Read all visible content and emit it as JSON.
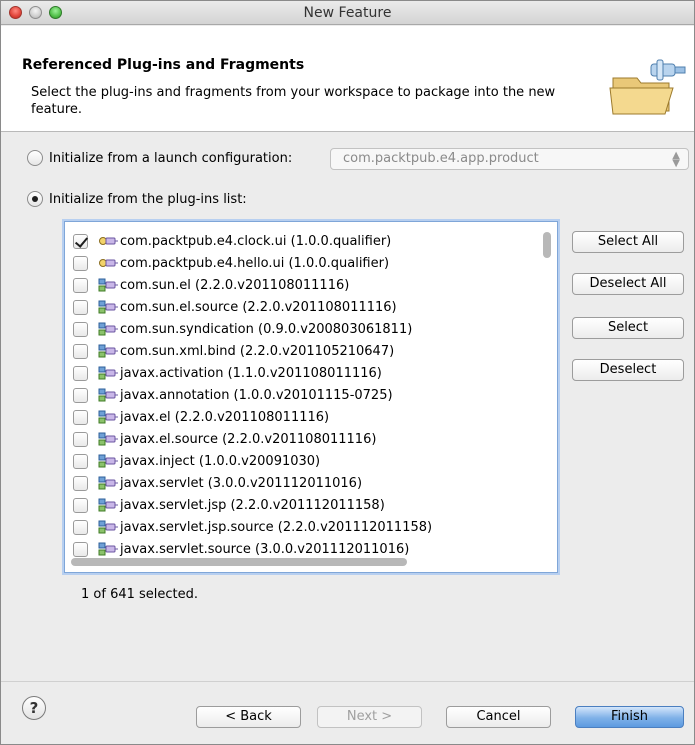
{
  "window": {
    "title": "New Feature"
  },
  "header": {
    "title": "Referenced Plug-ins and Fragments",
    "description": "Select the plug-ins and fragments from your workspace to package into the new feature."
  },
  "options": {
    "launch_config_label": "Initialize from a launch configuration:",
    "launch_config_value": "com.packtpub.e4.app.product",
    "plugins_list_label": "Initialize from the plug-ins list:",
    "selected_option": "plugins_list"
  },
  "plugins": [
    {
      "label": "com.packtpub.e4.clock.ui (1.0.0.qualifier)",
      "checked": true,
      "icon": "plugin-project-icon"
    },
    {
      "label": "com.packtpub.e4.hello.ui (1.0.0.qualifier)",
      "checked": false,
      "icon": "plugin-project-icon"
    },
    {
      "label": "com.sun.el (2.2.0.v201108011116)",
      "checked": false,
      "icon": "plugin-jar-icon"
    },
    {
      "label": "com.sun.el.source (2.2.0.v201108011116)",
      "checked": false,
      "icon": "plugin-jar-icon"
    },
    {
      "label": "com.sun.syndication (0.9.0.v200803061811)",
      "checked": false,
      "icon": "plugin-jar-icon"
    },
    {
      "label": "com.sun.xml.bind (2.2.0.v201105210647)",
      "checked": false,
      "icon": "plugin-jar-icon"
    },
    {
      "label": "javax.activation (1.1.0.v201108011116)",
      "checked": false,
      "icon": "plugin-jar-icon"
    },
    {
      "label": "javax.annotation (1.0.0.v20101115-0725)",
      "checked": false,
      "icon": "plugin-jar-icon"
    },
    {
      "label": "javax.el (2.2.0.v201108011116)",
      "checked": false,
      "icon": "plugin-jar-icon"
    },
    {
      "label": "javax.el.source (2.2.0.v201108011116)",
      "checked": false,
      "icon": "plugin-jar-icon"
    },
    {
      "label": "javax.inject (1.0.0.v20091030)",
      "checked": false,
      "icon": "plugin-jar-icon"
    },
    {
      "label": "javax.servlet (3.0.0.v201112011016)",
      "checked": false,
      "icon": "plugin-jar-icon"
    },
    {
      "label": "javax.servlet.jsp (2.2.0.v201112011158)",
      "checked": false,
      "icon": "plugin-jar-icon"
    },
    {
      "label": "javax.servlet.jsp.source (2.2.0.v201112011158)",
      "checked": false,
      "icon": "plugin-jar-icon"
    },
    {
      "label": "javax.servlet.source (3.0.0.v201112011016)",
      "checked": false,
      "icon": "plugin-jar-icon"
    }
  ],
  "side_buttons": {
    "select_all": "Select All",
    "deselect_all": "Deselect All",
    "select": "Select",
    "deselect": "Deselect"
  },
  "status": "1 of 641 selected.",
  "footer": {
    "help": "?",
    "back": "< Back",
    "next": "Next >",
    "cancel": "Cancel",
    "finish": "Finish"
  }
}
